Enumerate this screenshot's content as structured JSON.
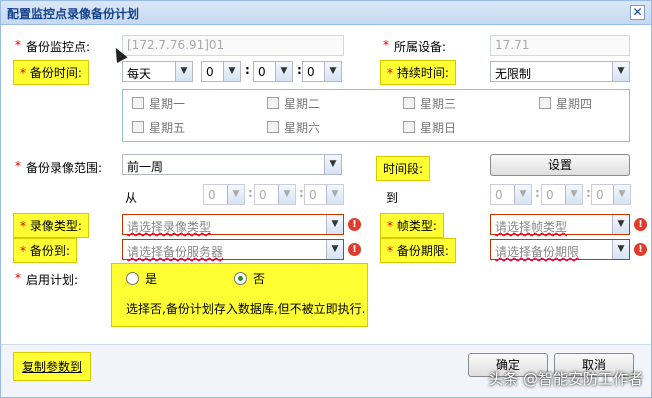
{
  "window": {
    "title": "配置监控点录像备份计划",
    "close_glyph": "✕"
  },
  "form": {
    "backup_point": {
      "label": "备份监控点:",
      "value": "[172.7.76.91]01"
    },
    "device": {
      "label": "所属设备:",
      "value": "17.71"
    },
    "backup_time": {
      "label": "备份时间:",
      "freq": "每天",
      "h": "0",
      "m": "0",
      "s": "0"
    },
    "duration": {
      "label": "持续时间:",
      "value": "无限制"
    },
    "weekdays": [
      "星期一",
      "星期二",
      "星期三",
      "星期四",
      "星期五",
      "星期六",
      "星期日"
    ],
    "range": {
      "label": "备份录像范围:",
      "value": "前一周"
    },
    "period": {
      "label": "时间段:",
      "button": "设置",
      "from": "从",
      "to": "到",
      "from_vals": [
        "0",
        "0",
        "0"
      ],
      "to_vals": [
        "0",
        "0",
        "0"
      ]
    },
    "record_type": {
      "label": "录像类型:",
      "placeholder": "请选择录像类型"
    },
    "frame_type": {
      "label": "帧类型:",
      "placeholder": "请选择帧类型"
    },
    "backup_to": {
      "label": "备份到:",
      "placeholder": "请选择备份服务器"
    },
    "backup_limit": {
      "label": "备份期限:",
      "placeholder": "请选择备份期限"
    },
    "enable": {
      "label": "启用计划:",
      "yes": "是",
      "no": "否",
      "selected": "否",
      "note": "选择否,备份计划存入数据库,但不被立即执行."
    },
    "required_mark": "*",
    "error_glyph": "!",
    "arrow_glyph": "▼"
  },
  "footer": {
    "copy_params": "复制参数到",
    "ok": "确定",
    "cancel": "取消"
  },
  "watermark": "头条 @智能安防工作者",
  "colors": {
    "highlight": "#ffff33",
    "title_text": "#15428b",
    "error": "#e03b2c"
  }
}
